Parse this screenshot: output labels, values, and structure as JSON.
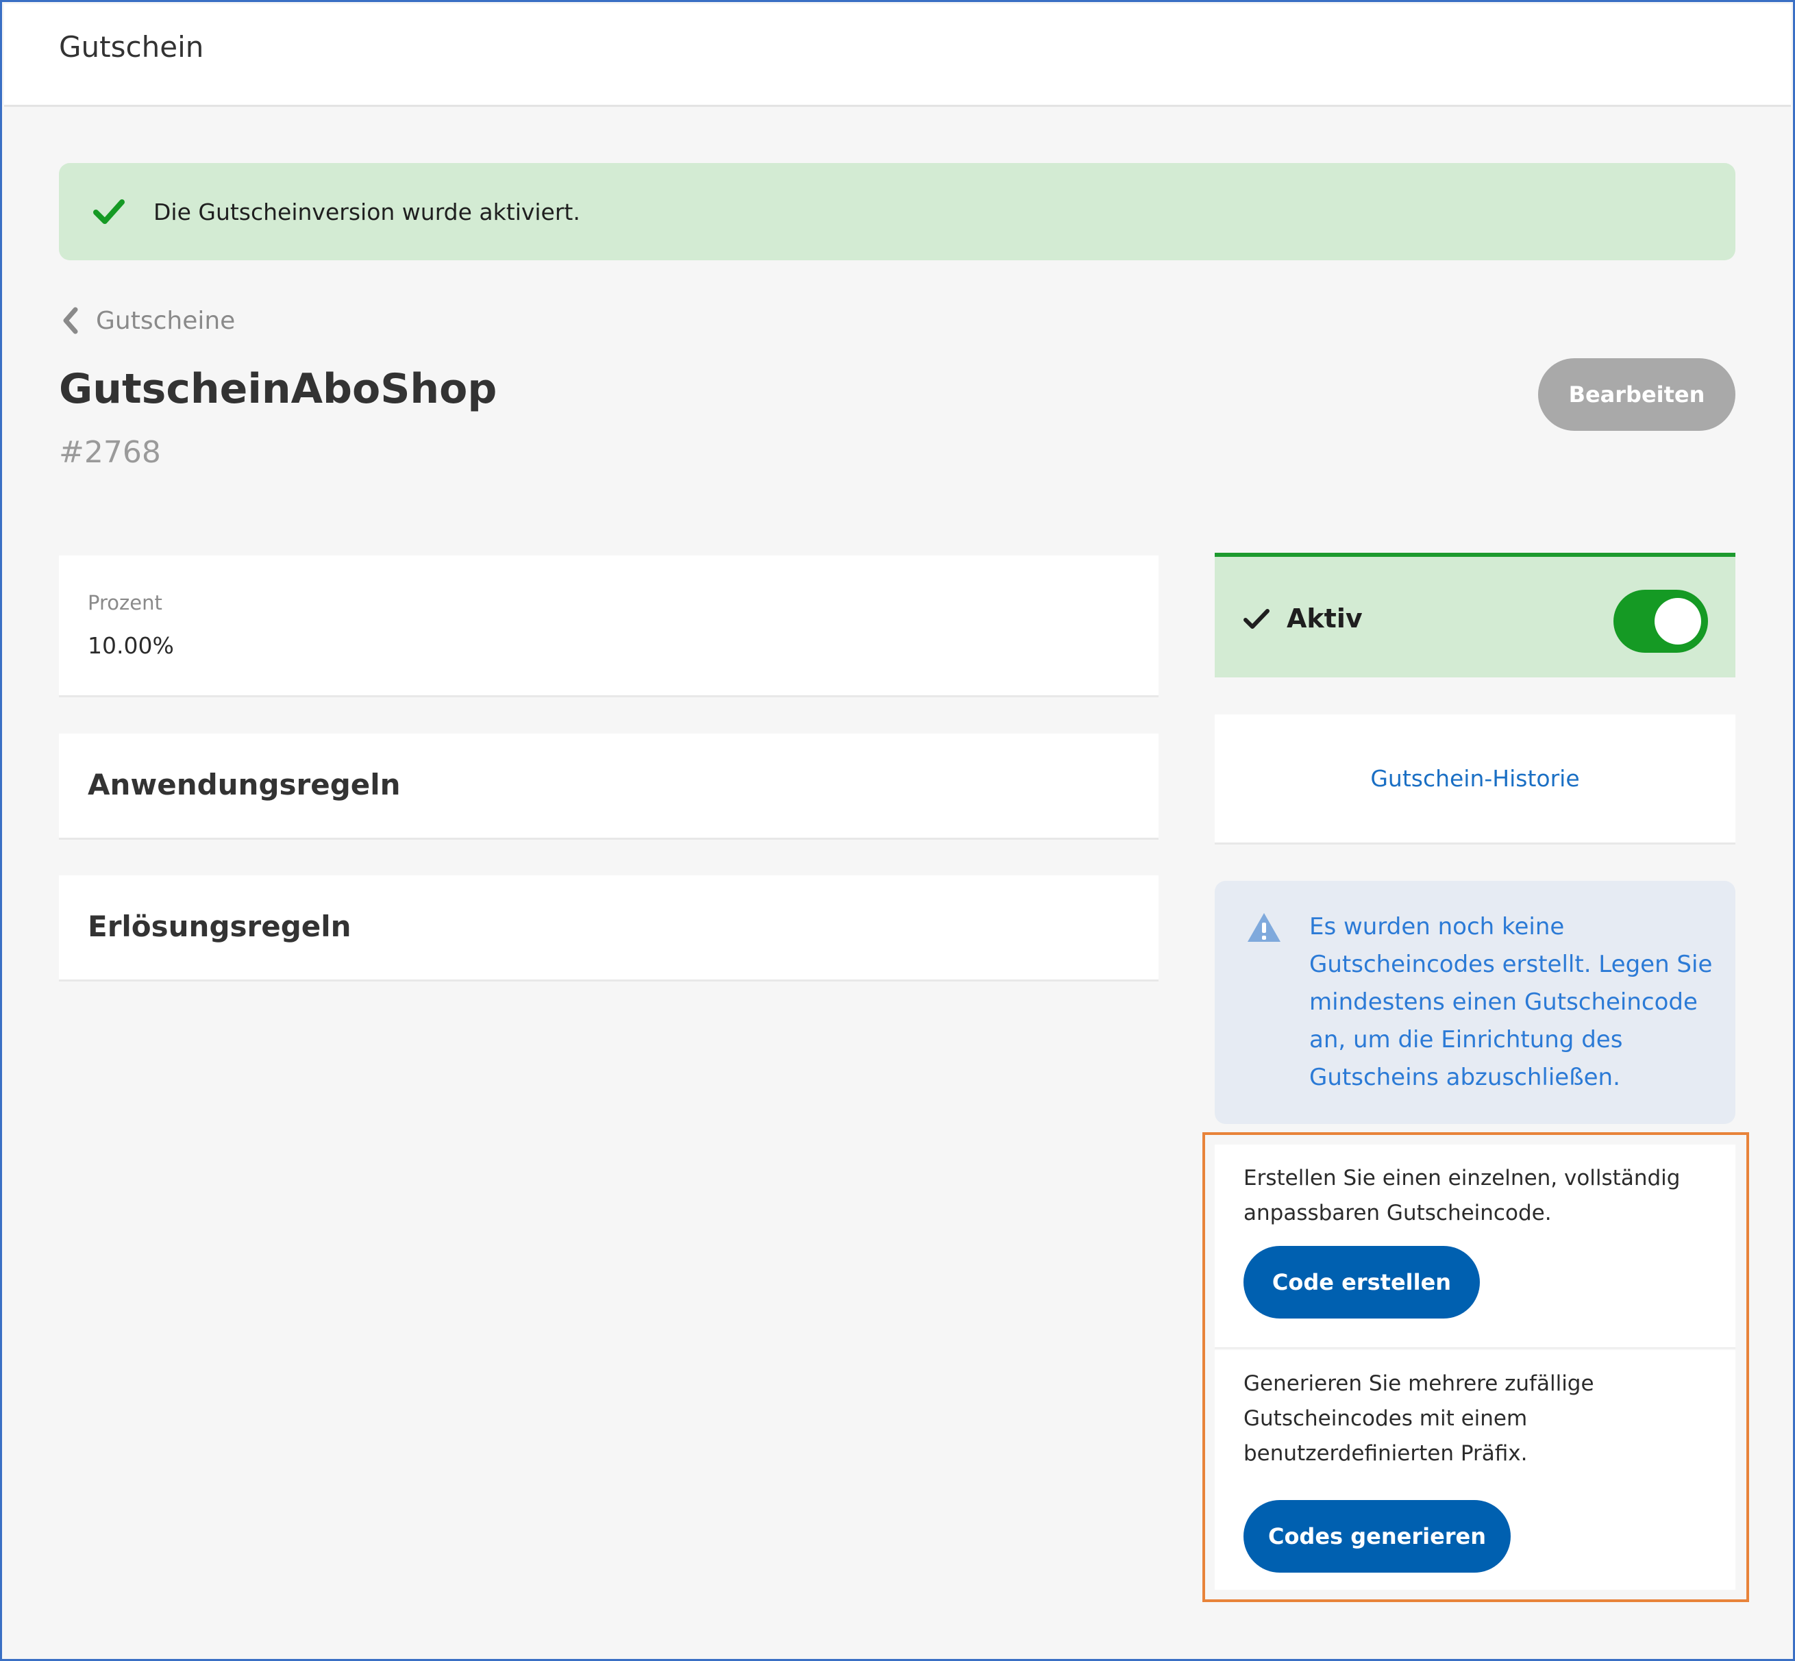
{
  "header": {
    "title": "Gutschein"
  },
  "alert": {
    "message": "Die Gutscheinversion wurde aktiviert.",
    "icon": "check-icon",
    "color": "#d3ebd3"
  },
  "breadcrumb": {
    "label": "Gutscheine",
    "icon": "chevron-left-icon"
  },
  "voucher": {
    "name": "GutscheinAboShop",
    "id": "#2768"
  },
  "actions": {
    "edit_label": "Bearbeiten"
  },
  "discount": {
    "label": "Prozent",
    "value": "10.00%"
  },
  "sections": {
    "application_rules": "Anwendungsregeln",
    "redemption_rules": "Erlösungsregeln"
  },
  "status": {
    "label": "Aktiv",
    "active": true,
    "accent": "#159a24"
  },
  "history": {
    "link_label": "Gutschein-Historie"
  },
  "warning": {
    "icon": "warning-triangle-icon",
    "message": "Es wurden noch keine Gutscheincodes erstellt. Legen Sie mindestens einen Gutscheincode an, um die Einrichtung des Gutscheins abzuschließen."
  },
  "codes": {
    "single": {
      "description": "Erstellen Sie einen einzelnen, vollständig anpassbaren Gutscheincode.",
      "button_label": "Code erstellen"
    },
    "multiple": {
      "description": "Generieren Sie mehrere zufällige Gutscheincodes mit einem benutzerdefinierten Präfix.",
      "button_label": "Codes generieren"
    }
  },
  "colors": {
    "primary": "#0060b0",
    "link": "#1a6fc4",
    "highlight": "#e8833a"
  }
}
